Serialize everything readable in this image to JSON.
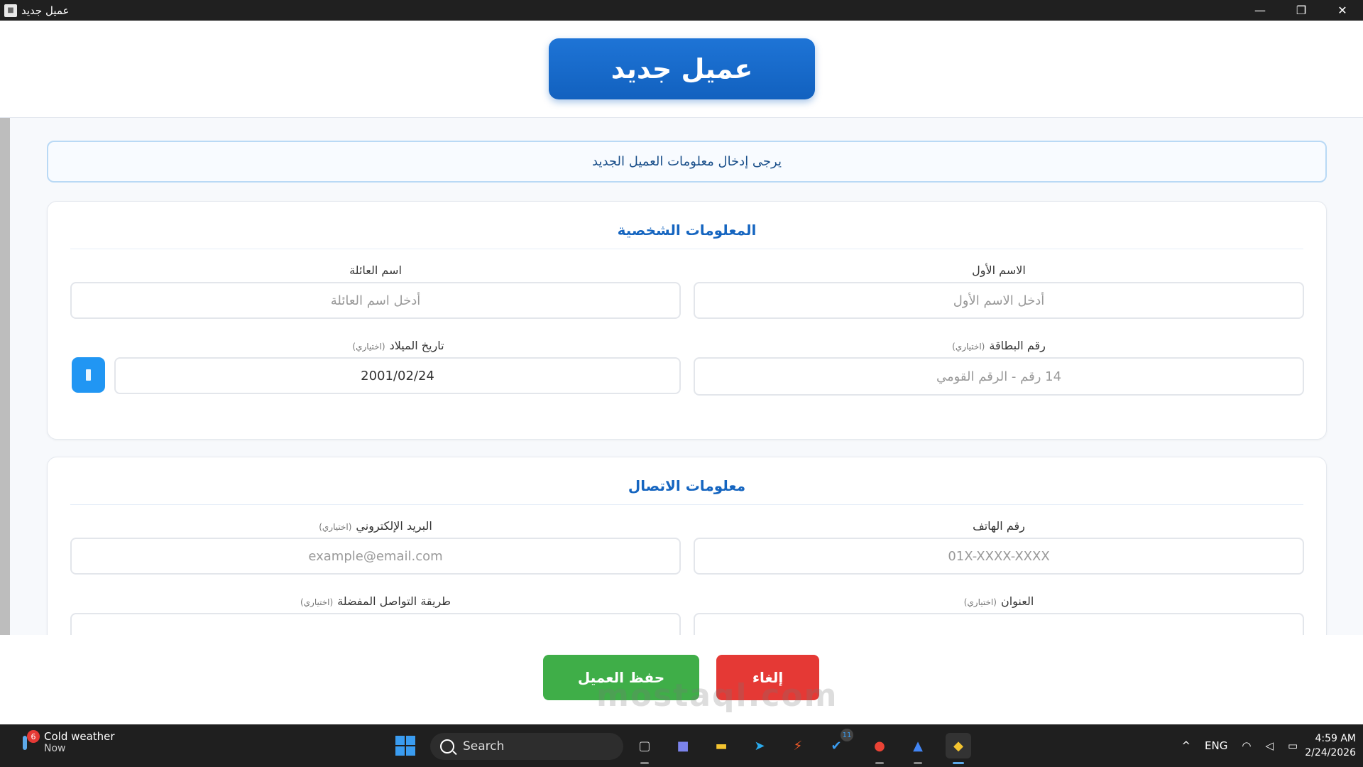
{
  "window": {
    "title": "عميل جديد",
    "minimize": "—",
    "maximize": "❐",
    "close": "✕"
  },
  "header": {
    "title": "عميل جديد"
  },
  "banner": {
    "text": "يرجى إدخال معلومات العميل الجديد"
  },
  "personal": {
    "title": "المعلومات الشخصية",
    "first_name": {
      "label": "الاسم الأول",
      "placeholder": "أدخل الاسم الأول"
    },
    "last_name": {
      "label": "اسم العائلة",
      "placeholder": "أدخل اسم العائلة"
    },
    "id_number": {
      "label": "رقم البطاقة",
      "optional": "(اختياري)",
      "placeholder": "14 رقم - الرقم القومي"
    },
    "birth_date": {
      "label": "تاريخ الميلاد",
      "optional": "(اختياري)",
      "value": "2001/02/24"
    }
  },
  "contact": {
    "title": "معلومات الاتصال",
    "phone": {
      "label": "رقم الهاتف",
      "placeholder": "01X-XXXX-XXXX"
    },
    "email": {
      "label": "البريد الإلكتروني",
      "optional": "(اختياري)",
      "placeholder": "example@email.com"
    },
    "address": {
      "label": "العنوان",
      "optional": "(اختياري)"
    },
    "contact_method": {
      "label": "طريقة التواصل المفضلة",
      "optional": "(اختياري)"
    }
  },
  "actions": {
    "save": "حفظ العميل",
    "cancel": "إلغاء"
  },
  "watermark": "mostaql.com",
  "taskbar": {
    "weather": {
      "title": "Cold weather",
      "sub": "Now",
      "badge": "6"
    },
    "search": "Search",
    "todo_badge": "11",
    "tray": {
      "lang": "ENG",
      "chevron": "^"
    },
    "clock": {
      "time": "4:59 AM",
      "date": "2/24/2026"
    }
  },
  "colors": {
    "primary": "#1565c0",
    "header_button": "#1e74d6",
    "save": "#3fae48",
    "cancel": "#e53935",
    "calendar_button": "#2196f3"
  },
  "icons": [
    "app-icon",
    "calendar-icon",
    "search-icon",
    "windows-start-icon",
    "file-explorer-icon",
    "teams-icon",
    "folder-icon",
    "telegram-icon",
    "flash-icon",
    "todo-icon",
    "chrome-icon",
    "arc-icon",
    "python-icon",
    "wifi-icon",
    "volume-icon",
    "battery-icon"
  ]
}
